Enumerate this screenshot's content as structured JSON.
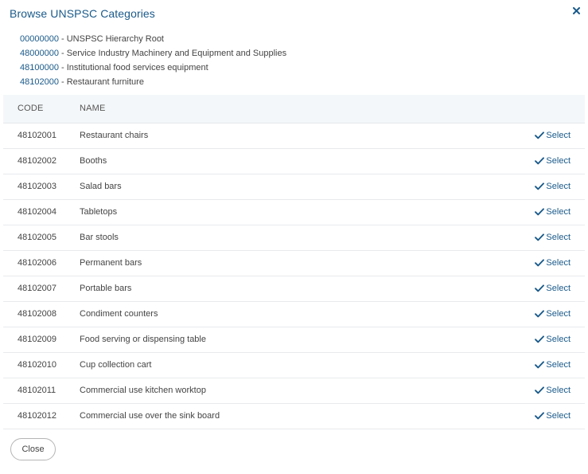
{
  "dialog": {
    "title": "Browse UNSPSC Categories",
    "close_label": "Close"
  },
  "breadcrumbs": [
    {
      "code": "00000000",
      "sep": " - ",
      "desc": "UNSPSC Hierarchy Root"
    },
    {
      "code": "48000000",
      "sep": " - ",
      "desc": "Service Industry Machinery and Equipment and Supplies"
    },
    {
      "code": "48100000",
      "sep": " - ",
      "desc": "Institutional food services equipment"
    },
    {
      "code": "48102000",
      "sep": " - ",
      "desc": "Restaurant furniture"
    }
  ],
  "table": {
    "headers": {
      "code": "CODE",
      "name": "NAME"
    },
    "select_label": "Select",
    "rows": [
      {
        "code": "48102001",
        "name": "Restaurant chairs"
      },
      {
        "code": "48102002",
        "name": "Booths"
      },
      {
        "code": "48102003",
        "name": "Salad bars"
      },
      {
        "code": "48102004",
        "name": "Tabletops"
      },
      {
        "code": "48102005",
        "name": "Bar stools"
      },
      {
        "code": "48102006",
        "name": "Permanent bars"
      },
      {
        "code": "48102007",
        "name": "Portable bars"
      },
      {
        "code": "48102008",
        "name": "Condiment counters"
      },
      {
        "code": "48102009",
        "name": "Food serving or dispensing table"
      },
      {
        "code": "48102010",
        "name": "Cup collection cart"
      },
      {
        "code": "48102011",
        "name": "Commercial use kitchen worktop"
      },
      {
        "code": "48102012",
        "name": "Commercial use over the sink board"
      }
    ]
  },
  "colors": {
    "accent": "#1a5a8a",
    "header_bg": "#f4f7f9"
  },
  "icons": {
    "close": "close-icon",
    "select": "checkmark-icon"
  }
}
